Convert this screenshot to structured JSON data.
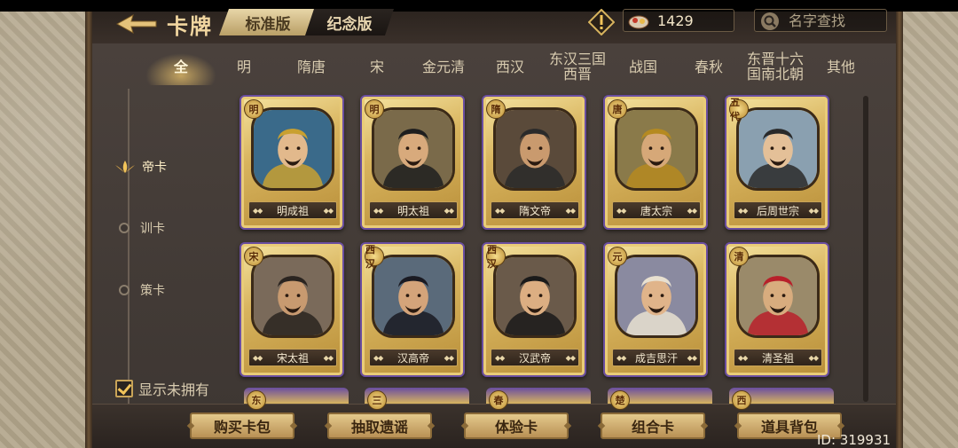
{
  "header": {
    "title": "卡牌",
    "version_tabs": [
      "标准版",
      "纪念版"
    ],
    "currency_value": "1429",
    "search_placeholder": "名字查找"
  },
  "era_tabs": [
    {
      "label": "全",
      "active": true
    },
    {
      "label": "明"
    },
    {
      "label": "隋唐"
    },
    {
      "label": "宋"
    },
    {
      "label": "金元清"
    },
    {
      "label": "西汉"
    },
    {
      "label": "东汉三国\n西晋"
    },
    {
      "label": "战国"
    },
    {
      "label": "春秋"
    },
    {
      "label": "东晋十六\n国南北朝"
    },
    {
      "label": "其他"
    }
  ],
  "categories": [
    {
      "label": "帝卡",
      "active": true
    },
    {
      "label": "训卡"
    },
    {
      "label": "策卡"
    }
  ],
  "show_unowned_label": "显示未拥有",
  "cards": [
    {
      "badge": "明",
      "name": "明成祖"
    },
    {
      "badge": "明",
      "name": "明太祖"
    },
    {
      "badge": "隋",
      "name": "隋文帝"
    },
    {
      "badge": "唐",
      "name": "唐太宗"
    },
    {
      "badge": "五代",
      "name": "后周世宗"
    },
    {
      "badge": "宋",
      "name": "宋太祖"
    },
    {
      "badge": "西汉",
      "name": "汉高帝"
    },
    {
      "badge": "西汉",
      "name": "汉武帝"
    },
    {
      "badge": "元",
      "name": "成吉思汗"
    },
    {
      "badge": "清",
      "name": "清圣祖"
    }
  ],
  "peek_badges": [
    "东",
    "三",
    "春",
    "楚",
    "西"
  ],
  "bottom_buttons": [
    "购买卡包",
    "抽取遗谣",
    "体验卡",
    "组合卡",
    "道具背包"
  ],
  "id_label": "ID: 319931",
  "colors": {
    "gold": "#d8b45e",
    "card_border": "#6a4ea0",
    "panel": "#3d3632"
  }
}
